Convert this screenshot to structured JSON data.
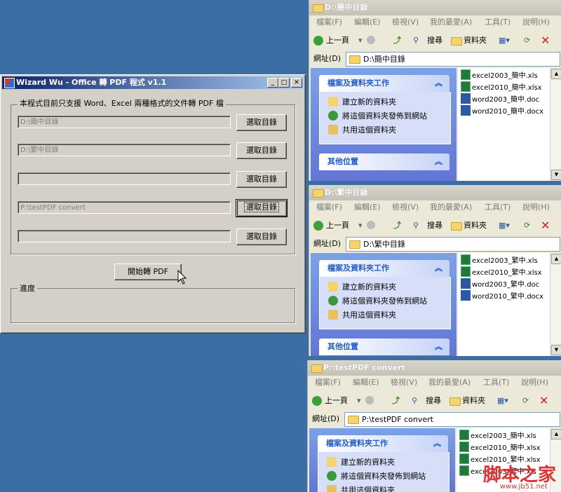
{
  "dialog": {
    "title": "Wizard Wu - Office 轉 PDF 程式 v1.1",
    "controls": {
      "minimize": "_",
      "maximize": "□",
      "close": "✕"
    },
    "description": "本程式目前只支援 Word、Excel 兩種格式的文件轉 PDF 檔",
    "rows": [
      {
        "value": "D:\\簡中目錄",
        "button": "選取目錄"
      },
      {
        "value": "D:\\繁中目錄",
        "button": "選取目錄"
      },
      {
        "value": "",
        "button": "選取目錄"
      },
      {
        "value": "P:\\testPDF convert",
        "button": "選取目錄"
      },
      {
        "value": "",
        "button": "選取目錄"
      }
    ],
    "start_button": "開始轉 PDF",
    "progress_label": "進度"
  },
  "explorer_common": {
    "menu": [
      "檔案(F)",
      "編輯(E)",
      "檢視(V)",
      "我的最愛(A)",
      "工具(T)",
      "說明(H)"
    ],
    "back_label": "上一頁",
    "search_label": "搜尋",
    "folders_label": "資料夾",
    "address_label": "網址(D)",
    "task_header": "檔案及資料夾工作",
    "tasks": [
      "建立新的資料夾",
      "將這個資料夾發佈到網站",
      "共用這個資料夾"
    ],
    "other_header": "其他位置"
  },
  "explorers": [
    {
      "title": "D:\\簡中目錄",
      "address": "D:\\簡中目錄",
      "files": [
        "excel2003_簡中.xls",
        "excel2010_簡中.xlsx",
        "word2003_簡中.doc",
        "word2010_簡中.docx"
      ]
    },
    {
      "title": "D:\\繁中目錄",
      "address": "D:\\繁中目錄",
      "files": [
        "excel2003_繁中.xls",
        "excel2010_繁中.xlsx",
        "word2003_繁中.doc",
        "word2010_繁中.docx"
      ]
    },
    {
      "title": "P:\\testPDF convert",
      "address": "P:\\testPDF convert",
      "files": [
        "excel2003_簡中.xls",
        "excel2010_簡中.xlsx",
        "excel2010_繁中.xlsx",
        "excel2003_繁中.xls"
      ]
    }
  ],
  "watermark": {
    "text": "脚本之家",
    "url": "www.jb51.net"
  }
}
